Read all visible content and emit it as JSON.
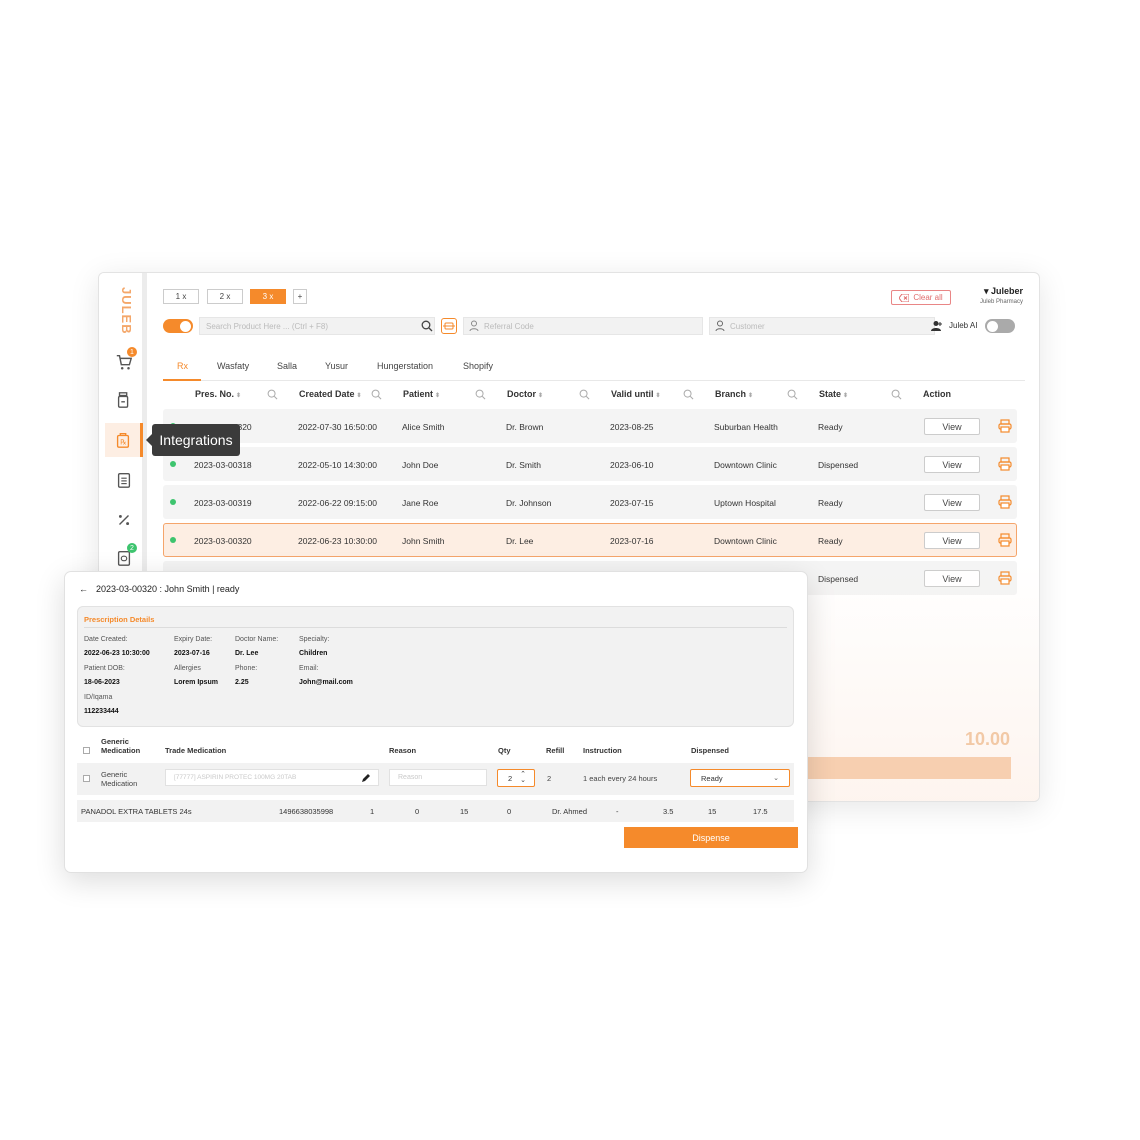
{
  "brand": {
    "logo": "JULEB",
    "accent": "#f58a2b",
    "ok": "#3dc46e"
  },
  "topbar": {
    "multipliers": [
      "1 x",
      "2 x",
      "3 x",
      "+"
    ],
    "active_multiplier": "3 x",
    "clear_all": "Clear all",
    "user_name": "Juleber",
    "user_sub": "Juleb Pharmacy"
  },
  "sidebar": {
    "tooltip": "Integrations",
    "cart_badge": "1",
    "rx_badge": "2"
  },
  "search": {
    "product_placeholder": "Search Product Here ... (Ctrl + F8)",
    "referral_placeholder": "Referral Code",
    "customer_placeholder": "Customer",
    "ai_label": "Juleb AI"
  },
  "tabs": [
    "Rx",
    "Wasfaty",
    "Salla",
    "Yusur",
    "Hungerstation",
    "Shopify"
  ],
  "table": {
    "headers": [
      "Pres. No.",
      "Created Date",
      "Patient",
      "Doctor",
      "Valid until",
      "Branch",
      "State",
      "Action"
    ],
    "rows": [
      {
        "pres": "2023-03-00320",
        "created": "2022-07-30 16:50:00",
        "patient": "Alice Smith",
        "doctor": "Dr. Brown",
        "valid": "2023-08-25",
        "branch": "Suburban Health",
        "state": "Ready",
        "action": "View"
      },
      {
        "pres": "2023-03-00318",
        "created": "2022-05-10 14:30:00",
        "patient": "John Doe",
        "doctor": "Dr. Smith",
        "valid": "2023-06-10",
        "branch": "Downtown Clinic",
        "state": "Dispensed",
        "action": "View"
      },
      {
        "pres": "2023-03-00319",
        "created": "2022-06-22 09:15:00",
        "patient": "Jane Roe",
        "doctor": "Dr. Johnson",
        "valid": "2023-07-15",
        "branch": "Uptown Hospital",
        "state": "Ready",
        "action": "View"
      },
      {
        "pres": "2023-03-00320",
        "created": "2022-06-23 10:30:00",
        "patient": "John Smith",
        "doctor": "Dr. Lee",
        "valid": "2023-07-16",
        "branch": "Downtown Clinic",
        "state": "Ready",
        "action": "View"
      },
      {
        "pres": "",
        "created": "",
        "patient": "",
        "doctor": "",
        "valid": "",
        "branch": "",
        "state": "Dispensed",
        "action": "View"
      }
    ]
  },
  "total": "10.00",
  "detail": {
    "title": "2023-03-00320 : John Smith | ready",
    "section_title": "Prescription Details",
    "fields": {
      "date_created_k": "Date Created:",
      "date_created_v": "2022-06-23 10:30:00",
      "expiry_k": "Expiry Date:",
      "expiry_v": "2023-07-16",
      "doctor_k": "Doctor Name:",
      "doctor_v": "Dr. Lee",
      "specialty_k": "Specialty:",
      "specialty_v": "Children",
      "dob_k": "Patient DOB:",
      "dob_v": "18-06-2023",
      "allergies_k": "Allergies",
      "allergies_v": "Lorem Ipsum",
      "phone_k": "Phone:",
      "phone_v": "2.25",
      "email_k": "Email:",
      "email_v": "John@mail.com",
      "id_k": "ID/Iqama",
      "id_v": "112233444"
    },
    "med_headers": {
      "generic_1": "Generic",
      "generic_2": "Medication",
      "trade": "Trade Medication",
      "reason": "Reason",
      "qty": "Qty",
      "refill": "Refill",
      "instruction": "Instruction",
      "dispensed": "Dispensed"
    },
    "med_row": {
      "generic_1": "Generic",
      "generic_2": "Medication",
      "trade_placeholder": "[77777] ASPIRIN PROTEC 100MG 20TAB",
      "reason_placeholder": "Reason",
      "qty": "2",
      "refill": "2",
      "instruction": "1 each every 24 hours",
      "dispensed": "Ready"
    },
    "product_row": [
      "PANADOL EXTRA TABLETS 24s",
      "1496638035998",
      "1",
      "0",
      "15",
      "0",
      "Dr. Ahmed",
      "-",
      "3.5",
      "15",
      "17.5"
    ],
    "dispense_label": "Dispense"
  }
}
